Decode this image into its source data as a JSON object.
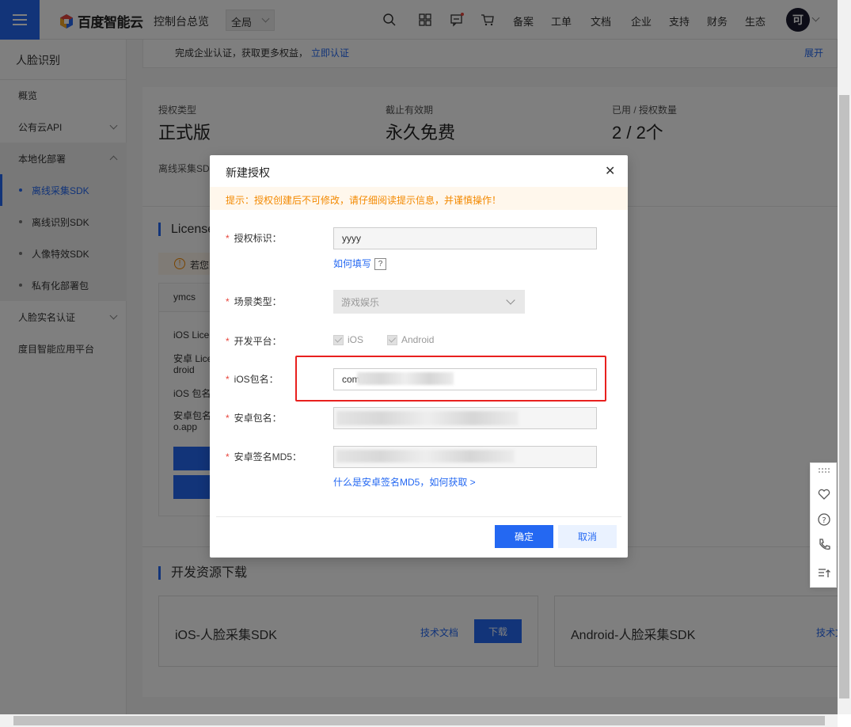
{
  "header": {
    "brand": "百度智能云",
    "console": "控制台总览",
    "region": "全局",
    "nav": [
      "备案",
      "工单",
      "文档",
      "企业",
      "支持",
      "财务",
      "生态"
    ],
    "avatar": "可",
    "icons": [
      "search-icon",
      "grid-icon",
      "message-icon",
      "cart-icon"
    ]
  },
  "sidebar": {
    "title": "人脸识别",
    "items": [
      {
        "label": "概览"
      },
      {
        "label": "公有云API"
      },
      {
        "label": "本地化部署"
      },
      {
        "label": "离线采集SDK"
      },
      {
        "label": "离线识别SDK"
      },
      {
        "label": "人像特效SDK"
      },
      {
        "label": "私有化部署包"
      },
      {
        "label": "人脸实名认证"
      },
      {
        "label": "度目智能应用平台"
      }
    ]
  },
  "main": {
    "notice_text": "完成企业认证，获取更多权益，",
    "notice_link": "立即认证",
    "notice_expand": "展开",
    "auth_type_label": "授权类型",
    "auth_type_value": "正式版",
    "expiry_label": "截止有效期",
    "expiry_value": "永久免费",
    "used_label": "已用 / 授权数量",
    "used_value": "2 / 2个",
    "offline_label": "离线采集SD",
    "license_title": "License",
    "warn_text": "若您",
    "card_name": "ymcs",
    "ios_lic": "iOS Lice",
    "android_lic": "安卓 Lice",
    "android_lic_2": "droid",
    "ios_pkg": "iOS 包名",
    "android_pkg": "安卓包名",
    "android_pkg_2": "o.app",
    "download_title": "开发资源下载",
    "sdk_ios": "iOS-人脸采集SDK",
    "sdk_ios_doc": "技术文档",
    "sdk_ios_download": "下载",
    "sdk_android": "Android-人脸采集SDK",
    "sdk_android_doc": "技术文"
  },
  "modal": {
    "title": "新建授权",
    "tip": "提示：授权创建后不可修改，请仔细阅读提示信息，并谨慎操作！",
    "fields": {
      "auth_id_label": "授权标识：",
      "auth_id_value": "yyyy",
      "how_to_fill": "如何填写",
      "scene_label": "场景类型：",
      "scene_value": "游戏娱乐",
      "platform_label": "开发平台：",
      "platform_ios": "iOS",
      "platform_android": "Android",
      "ios_pkg_label": "iOS包名：",
      "ios_pkg_value": "com",
      "android_pkg_label": "安卓包名：",
      "android_md5_label": "安卓签名MD5：",
      "md5_help": "什么是安卓签名MD5，如何获取 >"
    },
    "ok": "确定",
    "cancel": "取消"
  },
  "colors": {
    "primary": "#2468f2",
    "warning": "#f38900",
    "highlight": "#e8201e"
  }
}
